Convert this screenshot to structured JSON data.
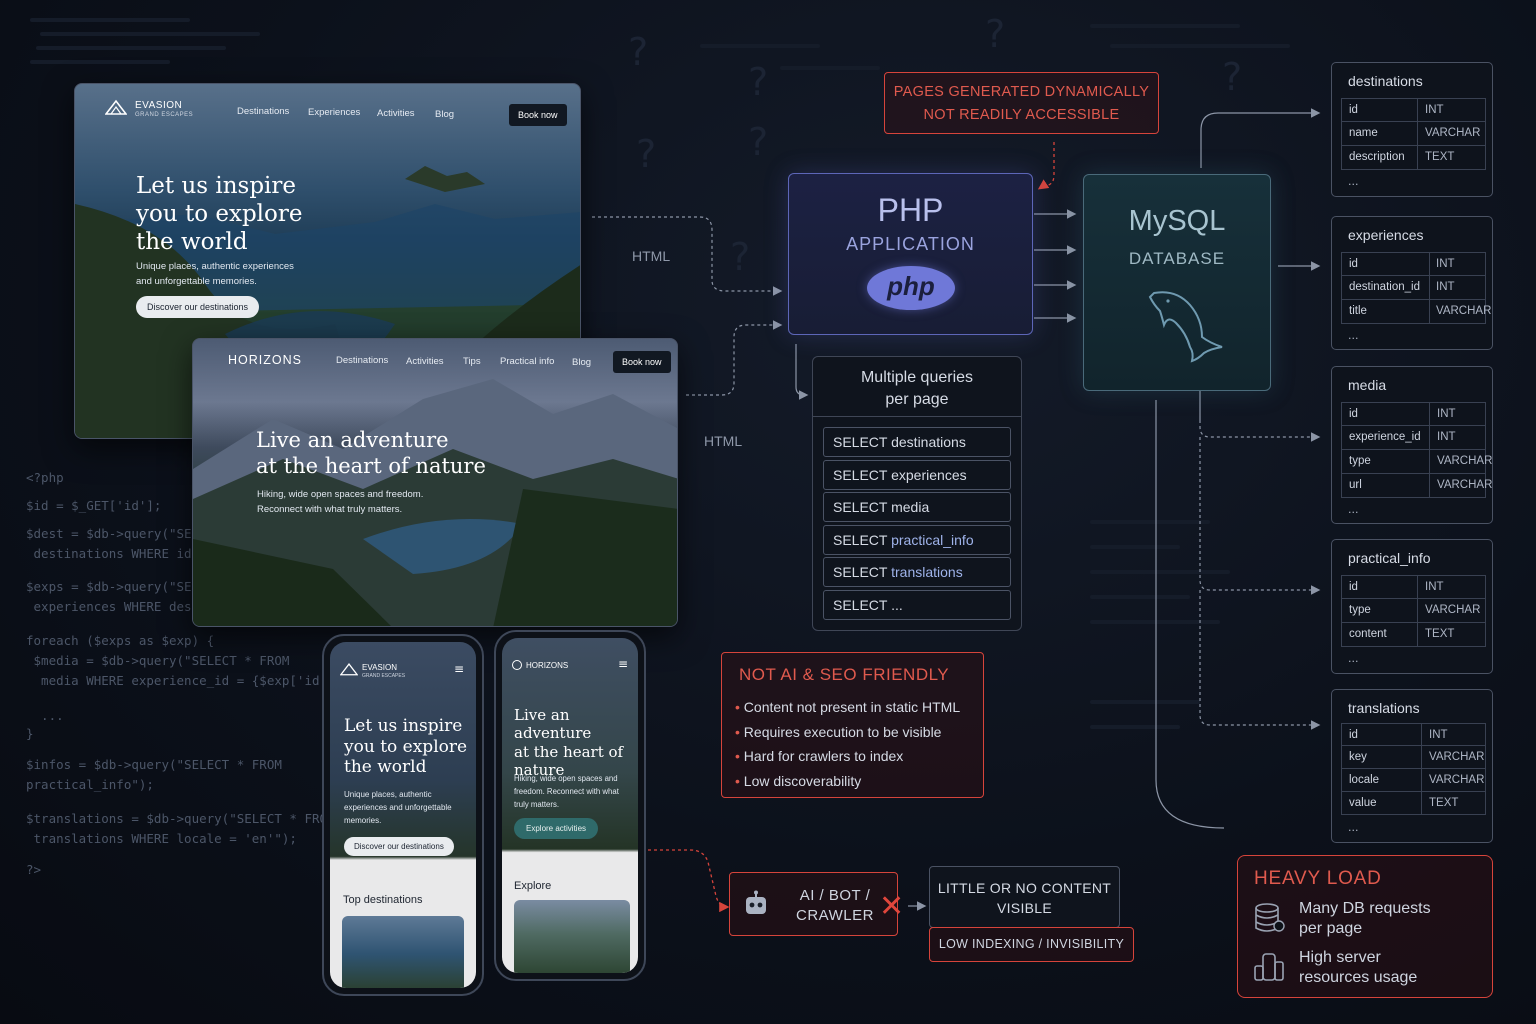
{
  "website_desktop": {
    "brand": "EVASION",
    "brand_sub": "GRAND ESCAPES",
    "nav": [
      "Destinations",
      "Experiences",
      "Activities",
      "Blog"
    ],
    "book_label": "Book now",
    "hero_lines": [
      "Let us inspire",
      "you to explore",
      "the world"
    ],
    "sub_lines": [
      "Unique places, authentic experiences",
      "and unforgettable memories."
    ],
    "cta": "Discover our destinations"
  },
  "website_horizons": {
    "brand": "HORIZONS",
    "nav": [
      "Destinations",
      "Activities",
      "Tips",
      "Practical info",
      "Blog"
    ],
    "book_label": "Book now",
    "hero_lines": [
      "Live an adventure",
      "at the heart of nature"
    ],
    "sub_lines": [
      "Hiking, wide open spaces and freedom.",
      "Reconnect with what truly matters."
    ]
  },
  "phone_evasion": {
    "brand": "EVASION",
    "brand_sub": "GRAND ESCAPES",
    "hero_lines": [
      "Let us inspire",
      "you to explore",
      "the world"
    ],
    "sub_lines": [
      "Unique places, authentic",
      "experiences and unforgettable",
      "memories."
    ],
    "cta": "Discover our destinations",
    "section": "Top destinations"
  },
  "phone_horizons": {
    "brand": "HORIZONS",
    "hero_lines": [
      "Live an adventure",
      "at the heart of",
      "nature"
    ],
    "sub_lines": [
      "Hiking, wide open spaces and",
      "freedom. Reconnect with what",
      "truly matters."
    ],
    "cta": "Explore activities",
    "section": "Explore"
  },
  "html_labels": [
    "HTML",
    "HTML"
  ],
  "code_lines": [
    "<?php",
    "$id = $_GET['id'];",
    "$dest = $db->query(\"SELECT * FROM",
    " destinations WHERE id = $id\")->fetch();",
    "$exps = $db->query(\"SELECT * FROM",
    " experiences WHERE destination_id = $id\");",
    "foreach ($exps as $exp) {",
    " $media = $db->query(\"SELECT * FROM",
    "  media WHERE experience_id = {$exp['id']}\"",
    "  ...",
    "}",
    "$infos = $db->query(\"SELECT * FROM",
    "practical_info\");",
    "$translations = $db->query(\"SELECT * FROM",
    " translations WHERE locale = 'en'\");",
    "?>"
  ],
  "dynamic_note": [
    "PAGES GENERATED DYNAMICALLY",
    "NOT READILY ACCESSIBLE"
  ],
  "php": {
    "title": "PHP",
    "subtitle": "APPLICATION",
    "logo": "php"
  },
  "mysql": {
    "title": "MySQL",
    "subtitle": "DATABASE",
    "icon": "dolphin-icon"
  },
  "queries": {
    "title_lines": [
      "Multiple queries",
      "per page"
    ],
    "items": [
      {
        "kw": "SELECT",
        "table": "destinations"
      },
      {
        "kw": "SELECT",
        "table": "experiences"
      },
      {
        "kw": "SELECT",
        "table": "media"
      },
      {
        "kw": "SELECT",
        "table": "practical_info"
      },
      {
        "kw": "SELECT",
        "table": "translations"
      },
      {
        "kw": "SELECT",
        "table": "..."
      }
    ]
  },
  "seo": {
    "title": "NOT AI & SEO FRIENDLY",
    "bullets": [
      "Content not present in static HTML",
      "Requires execution to be visible",
      "Hard for crawlers to index",
      "Low discoverability"
    ]
  },
  "bot": {
    "label_lines": [
      "AI / BOT /",
      "CRAWLER"
    ],
    "icon": "robot-icon"
  },
  "visibility": {
    "lines": [
      "LITTLE OR NO CONTENT",
      "VISIBLE"
    ],
    "footer": "LOW INDEXING / INVISIBILITY"
  },
  "heavy": {
    "title": "HEAVY LOAD",
    "items": [
      {
        "icon": "database-icon",
        "lines": [
          "Many DB requests",
          "per page"
        ]
      },
      {
        "icon": "server-icon",
        "lines": [
          "High server",
          "resources usage"
        ]
      }
    ]
  },
  "tables": [
    {
      "name": "destinations",
      "rows": [
        [
          "id",
          "INT"
        ],
        [
          "name",
          "VARCHAR"
        ],
        [
          "description",
          "TEXT"
        ]
      ],
      "more": "..."
    },
    {
      "name": "experiences",
      "rows": [
        [
          "id",
          "INT"
        ],
        [
          "destination_id",
          "INT"
        ],
        [
          "title",
          "VARCHAR"
        ]
      ],
      "more": "..."
    },
    {
      "name": "media",
      "rows": [
        [
          "id",
          "INT"
        ],
        [
          "experience_id",
          "INT"
        ],
        [
          "type",
          "VARCHAR"
        ],
        [
          "url",
          "VARCHAR"
        ]
      ],
      "more": "..."
    },
    {
      "name": "practical_info",
      "rows": [
        [
          "id",
          "INT"
        ],
        [
          "type",
          "VARCHAR"
        ],
        [
          "content",
          "TEXT"
        ]
      ],
      "more": "..."
    },
    {
      "name": "translations",
      "rows": [
        [
          "id",
          "INT"
        ],
        [
          "key",
          "VARCHAR"
        ],
        [
          "locale",
          "VARCHAR"
        ],
        [
          "value",
          "TEXT"
        ]
      ],
      "more": "..."
    }
  ],
  "colors": {
    "accent_red": "#e05a4e",
    "php_purple": "#6f78d8",
    "mysql_teal": "#5f8fa3",
    "background": "#0b1019"
  }
}
